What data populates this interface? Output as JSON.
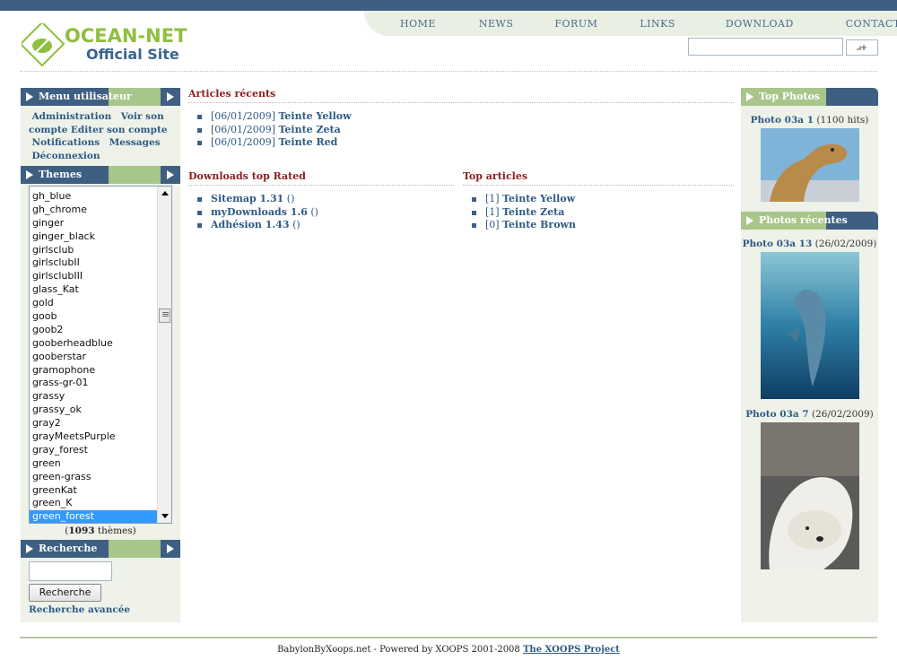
{
  "site": {
    "logo_line1": "OCEAN-NET",
    "logo_line2": "Official Site",
    "brand_colors": {
      "bar": "#3e5f82",
      "green": "#8fbf3e",
      "link": "#2e5a86",
      "title": "#8b1e1e"
    }
  },
  "nav": [
    "HOME",
    "NEWS",
    "FORUM",
    "LINKS",
    "DOWNLOAD",
    "CONTACT"
  ],
  "search_top": {
    "value": "",
    "button_label": ""
  },
  "usermenu": {
    "title": "Menu utilisateur",
    "items": [
      "Administration",
      "Voir son compte",
      "Editer son compte",
      "Notifications",
      "Messages",
      "Déconnexion"
    ]
  },
  "themes": {
    "title": "Themes",
    "items": [
      "gh_blue",
      "gh_chrome",
      "ginger",
      "ginger_black",
      "girlsclub",
      "girlsclubII",
      "girlsclubIII",
      "glass_Kat",
      "gold",
      "goob",
      "goob2",
      "gooberheadblue",
      "gooberstar",
      "gramophone",
      "grass-gr-01",
      "grassy",
      "grassy_ok",
      "gray2",
      "grayMeetsPurple",
      "gray_forest",
      "green",
      "green-grass",
      "greenKat",
      "green_K",
      "green_forest"
    ],
    "selected": "green_forest",
    "count": "1093",
    "count_suffix": "thèmes"
  },
  "search": {
    "title": "Recherche",
    "input_value": "",
    "button_label": "Recherche",
    "advanced": "Recherche avancée"
  },
  "recent_articles": {
    "title": "Articles récents",
    "items": [
      {
        "date": "[06/01/2009]",
        "name": "Teinte Yellow"
      },
      {
        "date": "[06/01/2009]",
        "name": "Teinte Zeta"
      },
      {
        "date": "[06/01/2009]",
        "name": "Teinte Red"
      }
    ]
  },
  "downloads": {
    "title": "Downloads top Rated",
    "items": [
      {
        "name": "Sitemap 1.31",
        "extra": "()"
      },
      {
        "name": "myDownloads 1.6",
        "extra": "()"
      },
      {
        "name": "Adhésion 1.43",
        "extra": "()"
      }
    ]
  },
  "top_articles": {
    "title": "Top articles",
    "items": [
      {
        "count": "[1]",
        "name": "Teinte Yellow"
      },
      {
        "count": "[1]",
        "name": "Teinte Zeta"
      },
      {
        "count": "[0]",
        "name": "Teinte Brown"
      }
    ]
  },
  "top_photos": {
    "title": "Top Photos",
    "items": [
      {
        "name": "Photo 03a 1",
        "meta": "(1100 hits)",
        "subject": "camel"
      }
    ]
  },
  "recent_photos": {
    "title": "Photos récentes",
    "items": [
      {
        "name": "Photo 03a 13",
        "meta": "(26/02/2009)",
        "subject": "dolphin"
      },
      {
        "name": "Photo 03a 7",
        "meta": "(26/02/2009)",
        "subject": "polar-bear"
      }
    ]
  },
  "footer": {
    "text": "BabylonByXoops.net - Powered by XOOPS 2001-2008",
    "link": "The XOOPS Project"
  }
}
